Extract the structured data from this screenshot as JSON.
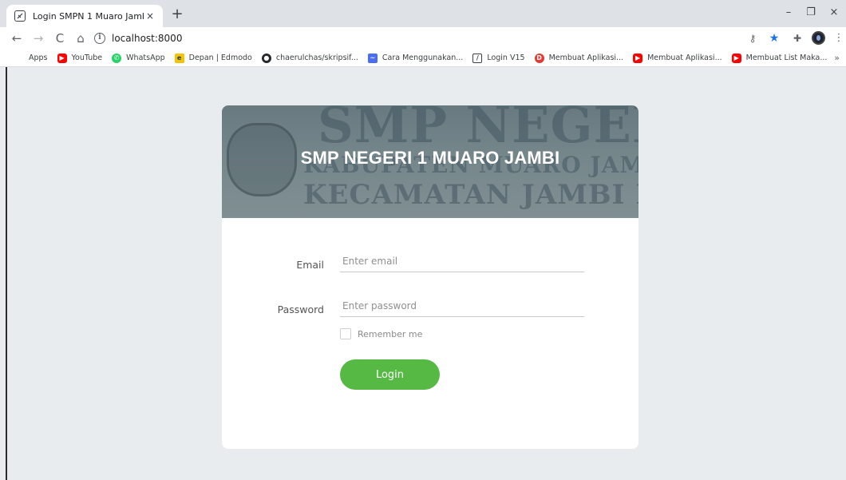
{
  "browser": {
    "tab_title": "Login SMPN 1 Muaro Jambi",
    "tab_close": "×",
    "new_tab": "+",
    "url": "localhost:8000",
    "window_controls": {
      "minimize": "–",
      "restore": "❐",
      "close": "×"
    },
    "bookmarks": [
      {
        "label": "Apps",
        "icon": "apps-grid-icon",
        "color": "#4285f4"
      },
      {
        "label": "YouTube",
        "icon": "youtube-icon",
        "color": "#ff0000"
      },
      {
        "label": "WhatsApp",
        "icon": "whatsapp-icon",
        "color": "#25d366"
      },
      {
        "label": "Depan | Edmodo",
        "icon": "edmodo-icon",
        "color": "#f5c400"
      },
      {
        "label": "chaerulchas/skripsif...",
        "icon": "github-icon",
        "color": "#24292e"
      },
      {
        "label": "Cara Menggunakan...",
        "icon": "bookmark-page-icon",
        "color": "#4a6cf7"
      },
      {
        "label": "Login V15",
        "icon": "bookmark-page-icon",
        "color": "#3c4043"
      },
      {
        "label": "Membuat Aplikasi...",
        "icon": "bookmark-page-icon",
        "color": "#e53935"
      },
      {
        "label": "Membuat Aplikasi...",
        "icon": "youtube-icon",
        "color": "#ff0000"
      },
      {
        "label": "Membuat List Maka...",
        "icon": "youtube-icon",
        "color": "#ff0000"
      }
    ],
    "bookmarks_more": "»"
  },
  "hero": {
    "title": "SMP NEGERI 1 MUARO JAMBI"
  },
  "form": {
    "email_label": "Email",
    "email_placeholder": "Enter email",
    "password_label": "Password",
    "password_placeholder": "Enter password",
    "remember_label": "Remember me",
    "login_label": "Login"
  }
}
